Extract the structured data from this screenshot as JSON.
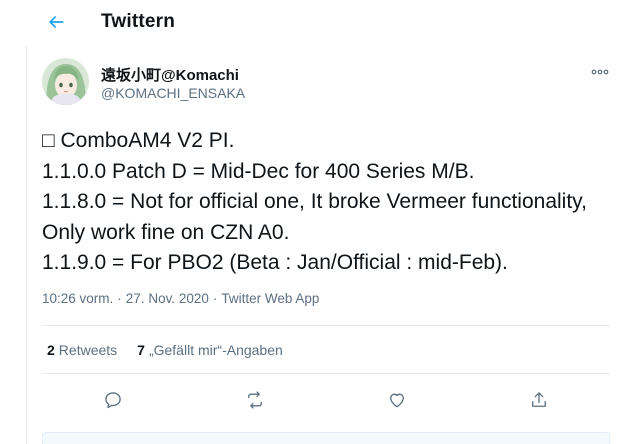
{
  "header": {
    "title": "Twittern"
  },
  "tweet": {
    "display_name": "遠坂小町@Komachi",
    "handle": "@KOMACHI_ENSAKA",
    "text": "□ ComboAM4 V2 PI.\n1.1.0.0 Patch D = Mid-Dec for 400 Series M/B.\n1.1.8.0 = Not for official one, It broke Vermeer functionality, Only work fine on CZN A0.\n1.1.9.0 = For PBO2 (Beta : Jan/Official : mid-Feb).",
    "time": "10:26 vorm.",
    "date": "27. Nov. 2020",
    "source": "Twitter Web App",
    "separator": "·",
    "retweets_count": "2",
    "retweets_label": "Retweets",
    "likes_count": "7",
    "likes_label": "„Gefällt mir“-Angaben"
  },
  "colors": {
    "accent": "#1da1f2",
    "text": "#0f1419",
    "secondary": "#5b7083",
    "border": "#e6ecf0"
  },
  "icons": {
    "back": "arrow-left-icon",
    "more": "more-dots-icon",
    "reply": "reply-icon",
    "retweet": "retweet-icon",
    "like": "heart-icon",
    "share": "share-icon"
  }
}
